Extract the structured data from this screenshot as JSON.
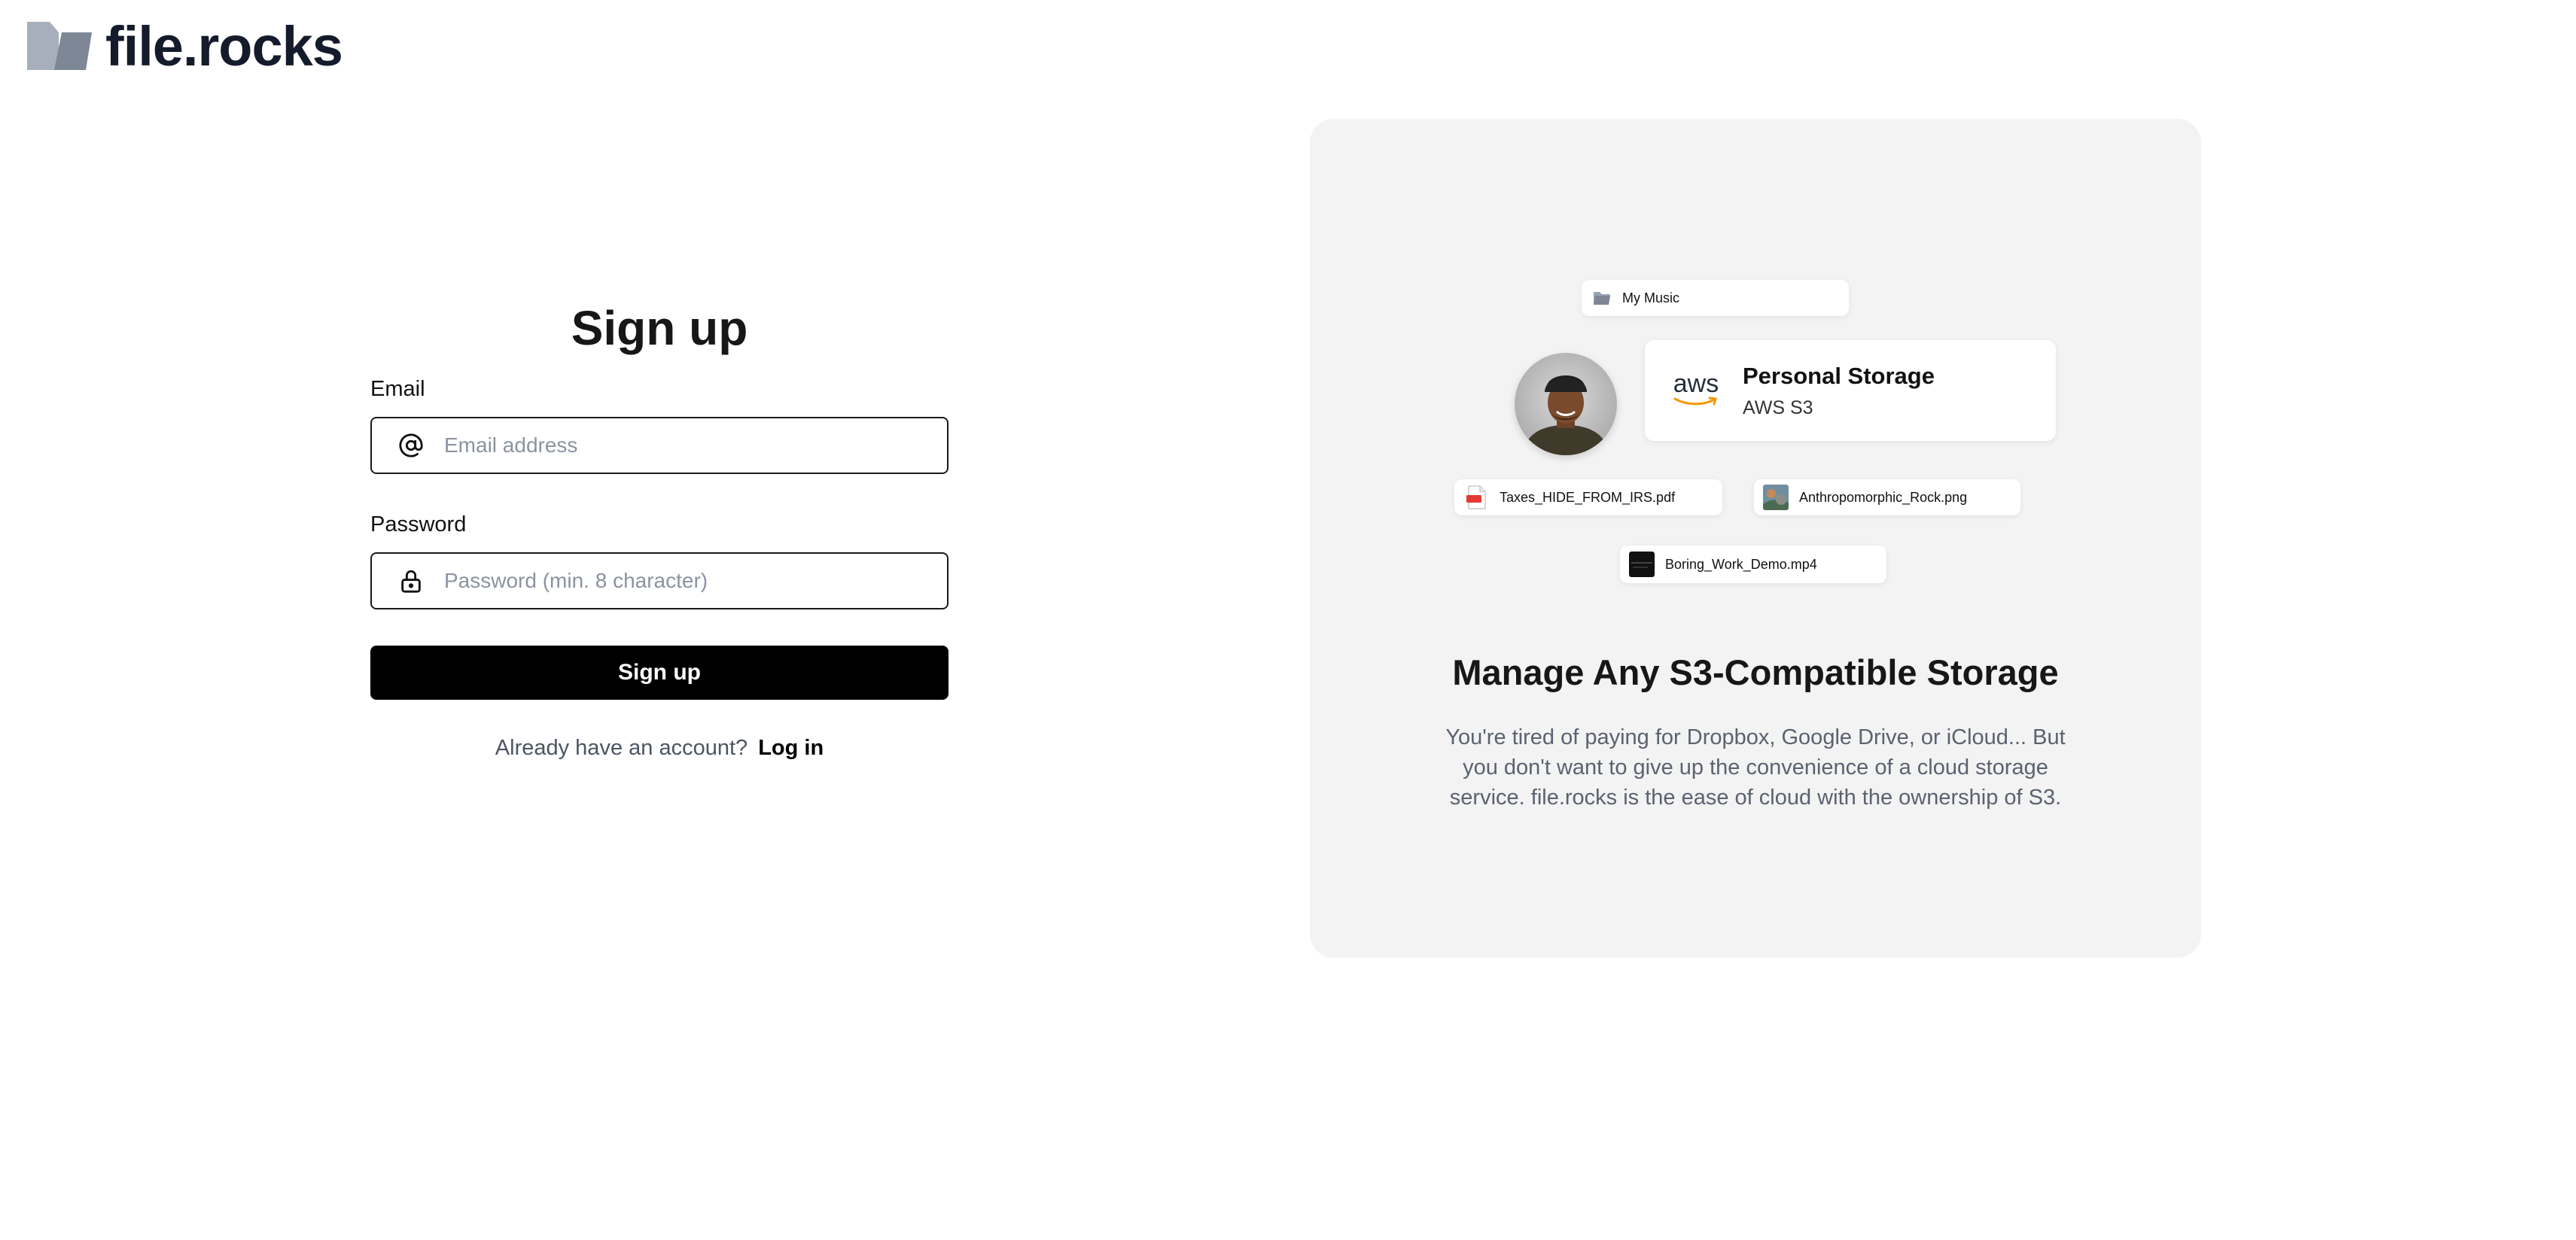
{
  "brand": {
    "name": "file.rocks",
    "logo_icon": "folder-logo-icon"
  },
  "signup_form": {
    "title": "Sign up",
    "email_label": "Email",
    "email_placeholder": "Email address",
    "email_value": "",
    "email_icon": "at-sign-icon",
    "password_label": "Password",
    "password_placeholder": "Password (min. 8 character)",
    "password_value": "",
    "password_icon": "lock-icon",
    "submit_label": "Sign up",
    "login_prompt": "Already have an account?",
    "login_link": "Log in"
  },
  "showcase": {
    "folder_chip": {
      "icon": "folder-icon",
      "label": "My Music"
    },
    "storage_card": {
      "provider_logo": "aws",
      "title": "Personal Storage",
      "subtitle": "AWS S3"
    },
    "files": [
      {
        "icon": "pdf-file-icon",
        "name": "Taxes_HIDE_FROM_IRS.pdf"
      },
      {
        "icon": "image-thumbnail",
        "name": "Anthropomorphic_Rock.png"
      },
      {
        "icon": "video-thumbnail",
        "name": "Boring_Work_Demo.mp4"
      }
    ],
    "heading": "Manage Any S3-Compatible Storage",
    "description": "You're tired of paying for Dropbox, Google Drive, or iCloud... But you don't want to give up the convenience of a cloud storage service. file.rocks is the ease of cloud with the ownership of S3."
  },
  "colors": {
    "button_bg": "#000000",
    "panel_bg": "#f3f3f3",
    "logo_gray": "#9aa3b2",
    "text_dark": "#141b2b"
  }
}
